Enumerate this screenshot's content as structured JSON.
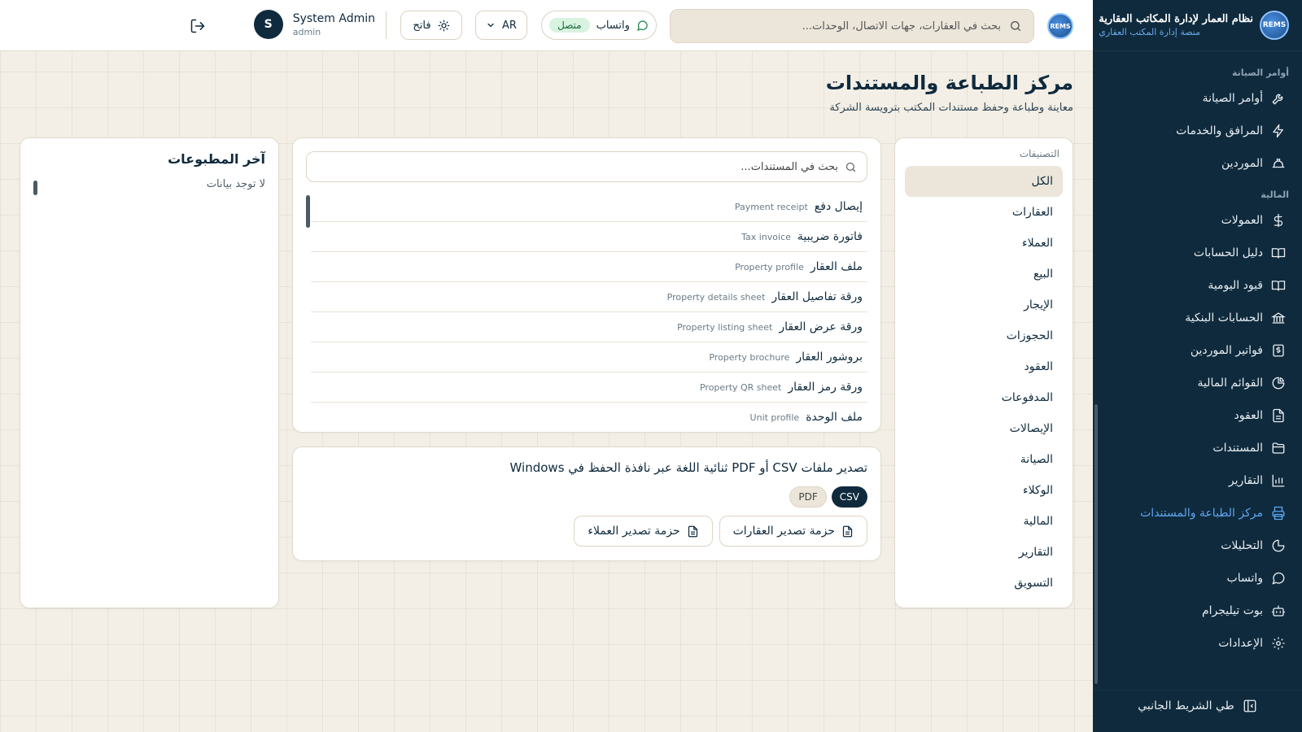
{
  "sidebar": {
    "brand_title": "نظام العمار لإدارة المكاتب العقارية",
    "brand_subtitle": "منصة إدارة المكتب العقاري",
    "logo_text": "REMS",
    "section_maintenance": "أوامر الصيانة",
    "section_finance": "المالية",
    "items": [
      {
        "label": "أوامر الصيانة",
        "icon": "wrench-icon"
      },
      {
        "label": "المرافق والخدمات",
        "icon": "bolt-icon"
      },
      {
        "label": "الموردين",
        "icon": "hardhat-icon"
      },
      {
        "label": "العمولات",
        "icon": "dollar-icon"
      },
      {
        "label": "دليل الحسابات",
        "icon": "book-icon"
      },
      {
        "label": "قيود اليومية",
        "icon": "book-open-icon"
      },
      {
        "label": "الحسابات البنكية",
        "icon": "bank-icon"
      },
      {
        "label": "فواتير الموردين",
        "icon": "invoice-icon"
      },
      {
        "label": "القوائم المالية",
        "icon": "pie-chart-icon"
      },
      {
        "label": "العقود",
        "icon": "document-icon"
      },
      {
        "label": "المستندات",
        "icon": "folder-icon"
      },
      {
        "label": "التقارير",
        "icon": "bar-chart-icon"
      },
      {
        "label": "مركز الطباعة والمستندات",
        "icon": "printer-icon"
      },
      {
        "label": "التحليلات",
        "icon": "analytics-icon"
      },
      {
        "label": "واتساب",
        "icon": "chat-icon"
      },
      {
        "label": "بوت تيليجرام",
        "icon": "bot-icon"
      },
      {
        "label": "الإعدادات",
        "icon": "gear-icon"
      }
    ],
    "collapse_label": "طي الشريط الجانبي"
  },
  "topbar": {
    "logo_text": "REMS",
    "search_placeholder": "بحث في العقارات، جهات الاتصال، الوحدات...",
    "whatsapp_label": "واتساب",
    "whatsapp_status": "متصل",
    "language": "AR",
    "theme_label": "فاتح",
    "user_name": "System Admin",
    "user_role": "admin",
    "user_initial": "S"
  },
  "page": {
    "title": "مركز الطباعة والمستندات",
    "subtitle": "معاينة وطباعة وحفظ مستندات المكتب بترويسة الشركة"
  },
  "categories": {
    "heading": "التصنيفات",
    "items": [
      "الكل",
      "العقارات",
      "العملاء",
      "البيع",
      "الإيجار",
      "الحجوزات",
      "العقود",
      "المدفوعات",
      "الإيصالات",
      "الصيانة",
      "الوكلاء",
      "المالية",
      "التقارير",
      "التسويق"
    ]
  },
  "documents": {
    "search_placeholder": "بحث في المستندات...",
    "items": [
      {
        "ar": "إيصال دفع",
        "en": "Payment receipt"
      },
      {
        "ar": "فاتورة ضريبية",
        "en": "Tax invoice"
      },
      {
        "ar": "ملف العقار",
        "en": "Property profile"
      },
      {
        "ar": "ورقة تفاصيل العقار",
        "en": "Property details sheet"
      },
      {
        "ar": "ورقة عرض العقار",
        "en": "Property listing sheet"
      },
      {
        "ar": "بروشور العقار",
        "en": "Property brochure"
      },
      {
        "ar": "ورقة رمز العقار",
        "en": "Property QR sheet"
      },
      {
        "ar": "ملف الوحدة",
        "en": "Unit profile"
      }
    ]
  },
  "export": {
    "title": "تصدير ملفات CSV أو PDF ثنائية اللغة عبر نافذة الحفظ في Windows",
    "format_csv": "CSV",
    "format_pdf": "PDF",
    "properties_button": "حزمة تصدير العقارات",
    "clients_button": "حزمة تصدير العملاء"
  },
  "recent": {
    "title": "آخر المطبوعات",
    "empty": "لا توجد بيانات"
  },
  "colors": {
    "navy": "#0f2a3d",
    "accent": "#5ea6f2",
    "beige": "#f3efe6",
    "success": "#1a6b3a"
  }
}
